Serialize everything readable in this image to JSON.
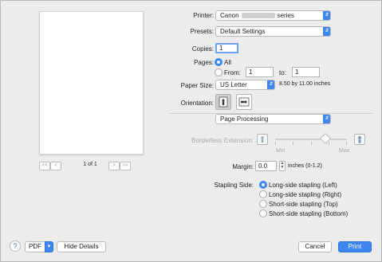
{
  "printer": {
    "label": "Printer:",
    "name_prefix": "Canon",
    "name_suffix": "series"
  },
  "presets": {
    "label": "Presets:",
    "value": "Default Settings"
  },
  "copies": {
    "label": "Copies:",
    "value": "1"
  },
  "pages": {
    "label": "Pages:",
    "all": "All",
    "from_label": "From:",
    "from_value": "1",
    "to_label": "to:",
    "to_value": "1"
  },
  "paper_size": {
    "label": "Paper Size:",
    "value": "US Letter",
    "dimensions": "8.50 by 11.00 inches"
  },
  "orientation": {
    "label": "Orientation:"
  },
  "section": {
    "value": "Page Processing"
  },
  "borderless": {
    "label": "Borderless Extension:",
    "min": "Min",
    "max": "Max",
    "level": 0.7
  },
  "margin": {
    "label": "Margin:",
    "value": "0.0",
    "unit": "inches (0-1.2)"
  },
  "stapling": {
    "label": "Stapling Side:",
    "options": [
      "Long-side stapling (Left)",
      "Long-side stapling (Right)",
      "Short-side stapling (Top)",
      "Short-side stapling (Bottom)"
    ]
  },
  "preview": {
    "page_count": "1 of 1",
    "nav_first": "<<",
    "nav_prev": "<",
    "nav_next": ">",
    "nav_last": ">>"
  },
  "footer": {
    "help": "?",
    "pdf": "PDF",
    "hide_details": "Hide Details",
    "cancel": "Cancel",
    "print": "Print"
  },
  "colors": {
    "accent": "#3d86f0",
    "background": "#ececec"
  }
}
